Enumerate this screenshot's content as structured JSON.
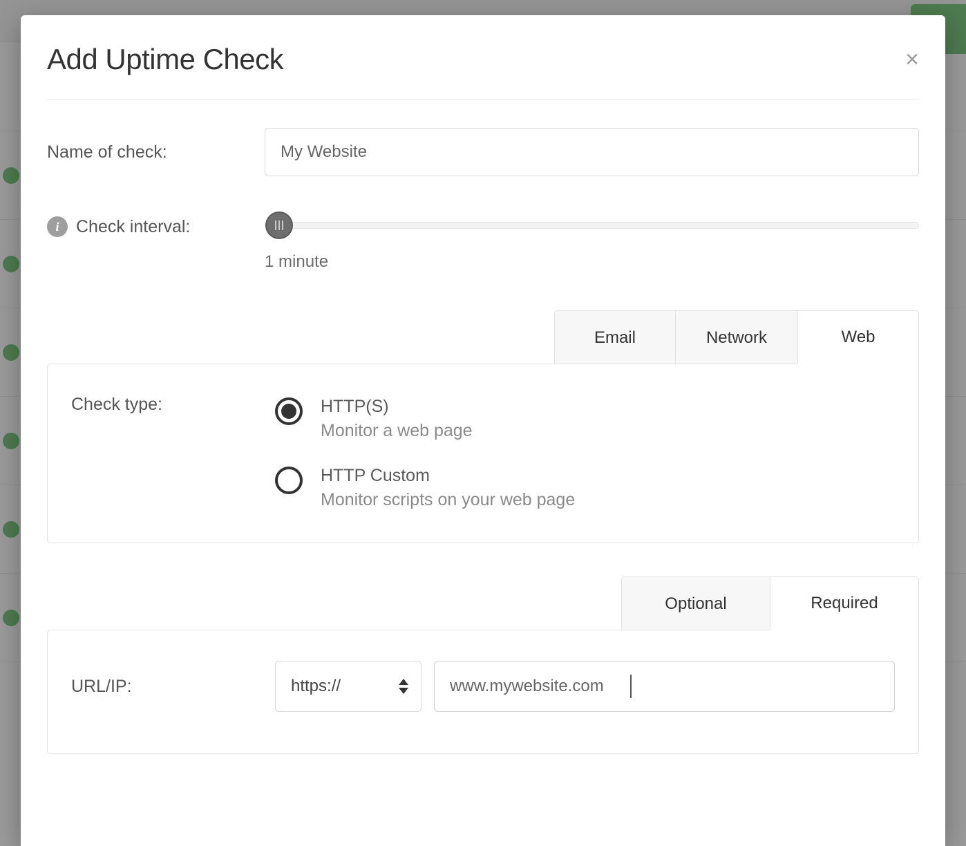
{
  "modal": {
    "title": "Add Uptime Check",
    "fields": {
      "name": {
        "label": "Name of check:",
        "value": "My Website"
      },
      "interval": {
        "label": "Check interval:",
        "value_label": "1 minute"
      },
      "checktype": {
        "label": "Check type:",
        "options": [
          {
            "title": "HTTP(S)",
            "subtitle": "Monitor a web page",
            "selected": true
          },
          {
            "title": "HTTP Custom",
            "subtitle": "Monitor scripts on your web page",
            "selected": false
          }
        ]
      },
      "url": {
        "label": "URL/IP:",
        "scheme": "https://",
        "value": "www.mywebsite.com"
      }
    },
    "category_tabs": [
      {
        "label": "Email",
        "active": false
      },
      {
        "label": "Network",
        "active": false
      },
      {
        "label": "Web",
        "active": true
      }
    ],
    "settings_tabs": [
      {
        "label": "Optional",
        "active": false
      },
      {
        "label": "Required",
        "active": true
      }
    ]
  }
}
